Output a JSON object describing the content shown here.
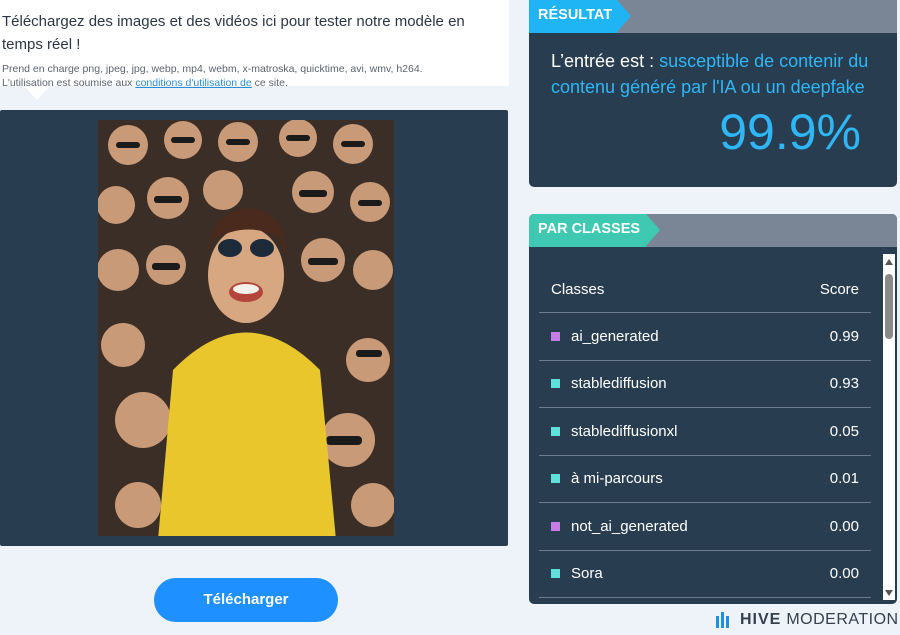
{
  "intro": {
    "heading": "Téléchargez des images et des vidéos ici pour tester notre modèle en temps réel !",
    "formats_text": "Prend en charge png, jpeg, jpg, webp, mp4, webm, x-matroska, quicktime, avi, wmv, h264.",
    "terms_prefix": "L'utilisation est soumise aux ",
    "terms_link": "conditions d'utilisation de",
    "terms_suffix": " ce site."
  },
  "preview": {
    "image_description": "Photo d'une foule souriante portant des lunettes de soleil, une femme en chemise jaune au centre"
  },
  "upload": {
    "button_label": "Télécharger"
  },
  "result": {
    "tag": "RÉSULTAT",
    "prefix": "L’entrée est : ",
    "verdict": "susceptible de contenir du contenu généré par l'IA ou un deepfake",
    "percent": "99.9%"
  },
  "classes": {
    "tag": "PAR CLASSES",
    "col_class": "Classes",
    "col_score": "Score",
    "rows": [
      {
        "name": "ai_generated",
        "score": "0.99",
        "color": "#c77de6"
      },
      {
        "name": "stablediffusion",
        "score": "0.93",
        "color": "#5fe0db"
      },
      {
        "name": "stablediffusionxl",
        "score": "0.05",
        "color": "#5fe0db"
      },
      {
        "name": "à mi-parcours",
        "score": "0.01",
        "color": "#5fe0db"
      },
      {
        "name": "not_ai_generated",
        "score": "0.00",
        "color": "#c77de6"
      },
      {
        "name": "Sora",
        "score": "0.00",
        "color": "#5fe0db"
      }
    ]
  },
  "brand": {
    "hive": "HIVE",
    "moderation": "MODERATION"
  },
  "colors": {
    "panel": "#293d51",
    "result_accent": "#1fb4f3",
    "classes_accent": "#3fc9b3",
    "button": "#1e90ff"
  }
}
